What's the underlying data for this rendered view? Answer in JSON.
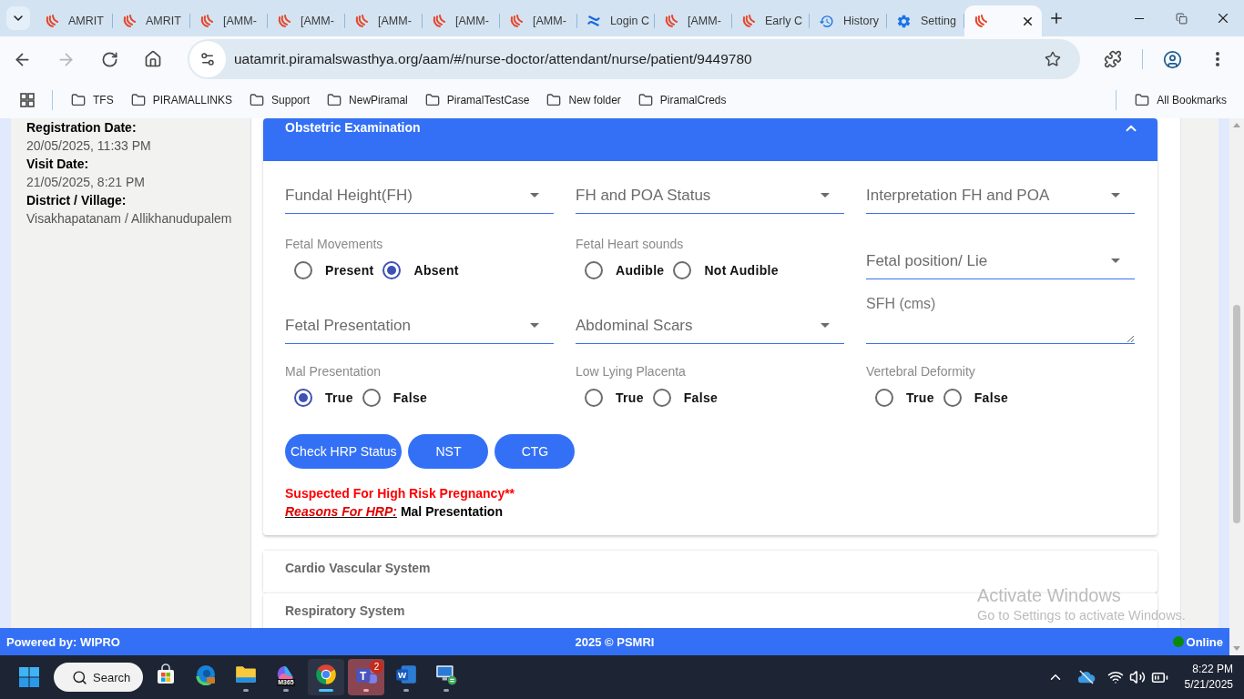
{
  "browser": {
    "tabs": [
      {
        "title": "AMRIT",
        "kind": "flame",
        "selected": false
      },
      {
        "title": "AMRIT",
        "kind": "flame",
        "selected": false
      },
      {
        "title": "[AMM-",
        "kind": "flame",
        "selected": false
      },
      {
        "title": "[AMM-",
        "kind": "flame",
        "selected": false
      },
      {
        "title": "[AMM-",
        "kind": "flame",
        "selected": false
      },
      {
        "title": "[AMM-",
        "kind": "flame",
        "selected": false
      },
      {
        "title": "[AMM-",
        "kind": "flame",
        "selected": false
      },
      {
        "title": "Login C",
        "kind": "cross",
        "selected": false
      },
      {
        "title": "[AMM-",
        "kind": "flame",
        "selected": false
      },
      {
        "title": "Early C",
        "kind": "flame",
        "selected": false
      },
      {
        "title": "History",
        "kind": "history",
        "selected": false
      },
      {
        "title": "Setting",
        "kind": "gear",
        "selected": false
      },
      {
        "kind": "flame",
        "selected": true
      }
    ],
    "navigation": {
      "back_enabled": true,
      "forward_enabled": false
    },
    "url": "uatamrit.piramalswasthya.org/aam/#/nurse-doctor/attendant/nurse/patient/9449780",
    "bookmarks": [
      "TFS",
      "PIRAMALLINKS",
      "Support",
      "NewPiramal",
      "PiramalTestCase",
      "New folder",
      "PiramalCreds"
    ],
    "all_bookmarks": "All Bookmarks"
  },
  "patient_info": [
    {
      "label": "Registration Date:",
      "value": "20/05/2025, 11:33 PM"
    },
    {
      "label": "Visit Date:",
      "value": "21/05/2025, 8:21 PM"
    },
    {
      "label": "District / Village:",
      "value": "Visakhapatanam / Allikhanudupalem"
    }
  ],
  "sections": [
    {
      "title": "Obstetric Examination",
      "expanded": true,
      "fields": [
        {
          "kind": "select",
          "placeholder": "Fundal Height(FH)"
        },
        {
          "kind": "select",
          "placeholder": "FH and POA Status"
        },
        {
          "kind": "select",
          "placeholder": "Interpretation FH and POA"
        },
        {
          "kind": "radio",
          "label": "Fetal Movements",
          "options": [
            {
              "label": "Present",
              "selected": false
            },
            {
              "label": "Absent",
              "selected": true
            }
          ]
        },
        {
          "kind": "radio",
          "label": "Fetal Heart sounds",
          "options": [
            {
              "label": "Audible",
              "selected": false
            },
            {
              "label": "Not Audible",
              "selected": false
            }
          ]
        },
        {
          "kind": "select",
          "placeholder": "Fetal position/ Lie"
        },
        {
          "kind": "select",
          "placeholder": "Fetal Presentation"
        },
        {
          "kind": "select",
          "placeholder": "Abdominal Scars"
        },
        {
          "kind": "textarea",
          "placeholder": "SFH (cms)"
        },
        {
          "kind": "radio",
          "label": "Mal Presentation",
          "options": [
            {
              "label": "True",
              "selected": true
            },
            {
              "label": "False",
              "selected": false
            }
          ]
        },
        {
          "kind": "radio",
          "label": "Low Lying Placenta",
          "options": [
            {
              "label": "True",
              "selected": false
            },
            {
              "label": "False",
              "selected": false
            }
          ]
        },
        {
          "kind": "radio",
          "label": "Vertebral Deformity",
          "options": [
            {
              "label": "True",
              "selected": false
            },
            {
              "label": "False",
              "selected": false
            }
          ]
        }
      ],
      "actions": [
        "Check HRP Status",
        "NST",
        "CTG"
      ],
      "hrp_alert": {
        "title": "Suspected For High Risk Pregnancy**",
        "reasons_label": "Reasons For HRP:",
        "reasons": "Mal Presentation"
      }
    },
    {
      "title": "Cardio Vascular System",
      "expanded": false
    },
    {
      "title": "Respiratory System",
      "expanded": false
    }
  ],
  "footer": {
    "powered_by": "Powered by: WIPRO",
    "copyright": "2025 © PSMRI",
    "status": "Online",
    "online": true
  },
  "activation_notice": {
    "title": "Activate Windows",
    "message": "Go to Settings to activate Windows."
  },
  "taskbar": {
    "search": "Search",
    "apps": [
      {
        "kind": "store",
        "running": false,
        "active": false,
        "flashing": false
      },
      {
        "kind": "edge",
        "running": false,
        "active": false,
        "flashing": false
      },
      {
        "kind": "explorer",
        "running": true,
        "active": false,
        "flashing": false
      },
      {
        "kind": "m365",
        "label": "M365",
        "running": true,
        "active": false,
        "flashing": false
      },
      {
        "kind": "chrome",
        "running": true,
        "active": true,
        "flashing": false
      },
      {
        "kind": "teams",
        "glyph": "T",
        "badge": "2",
        "running": true,
        "active": false,
        "flashing": true
      },
      {
        "kind": "word",
        "glyph": "W",
        "running": true,
        "active": false,
        "flashing": false
      },
      {
        "kind": "remote_desktop",
        "running": true,
        "active": false,
        "flashing": false
      }
    ],
    "clock": {
      "time": "8:22 PM",
      "date": "5/21/2025"
    }
  }
}
